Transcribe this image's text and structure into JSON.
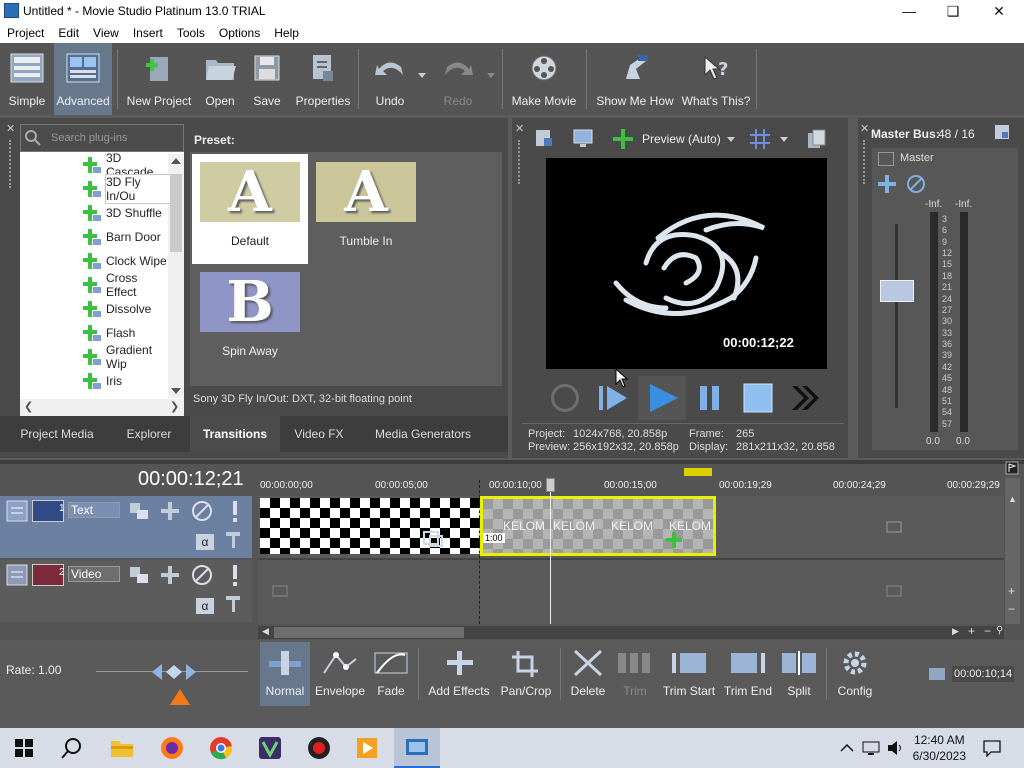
{
  "window": {
    "title": "Untitled * - Movie Studio Platinum 13.0 TRIAL"
  },
  "menu": [
    "Project",
    "Edit",
    "View",
    "Insert",
    "Tools",
    "Options",
    "Help"
  ],
  "toolbar": {
    "simple": "Simple",
    "advanced": "Advanced",
    "new_project": "New Project",
    "open": "Open",
    "save": "Save",
    "properties": "Properties",
    "undo": "Undo",
    "redo": "Redo",
    "make_movie": "Make Movie",
    "show_me_how": "Show Me How",
    "whats_this": "What's This?"
  },
  "plugins": {
    "search_placeholder": "Search plug-ins",
    "items": [
      "3D Cascade",
      "3D Fly In/Ou",
      "3D Shuffle",
      "Barn Door",
      "Clock Wipe",
      "Cross Effect",
      "Dissolve",
      "Flash",
      "Gradient Wip",
      "Iris"
    ],
    "selected_index": 1
  },
  "presets": {
    "heading": "Preset:",
    "items": [
      {
        "label": "Default",
        "glyph": "A"
      },
      {
        "label": "Tumble In",
        "glyph": "A"
      },
      {
        "label": "Spin Away",
        "glyph": "B"
      }
    ],
    "status": "Sony 3D Fly In/Out: DXT, 32-bit floating point"
  },
  "tabs": [
    "Project Media",
    "Explorer",
    "Transitions",
    "Video FX",
    "Media Generators"
  ],
  "preview": {
    "mode": "Preview (Auto)",
    "timecode": "00:00:12;22",
    "project_label": "Project:",
    "project_value": "1024x768, 20.858p",
    "preview_label": "Preview:",
    "preview_value": "256x192x32, 20.858p",
    "frame_label": "Frame:",
    "frame_value": "265",
    "display_label": "Display:",
    "display_value": "281x211x32, 20.858"
  },
  "master": {
    "title": "Master Bus:",
    "count": "48 / 16",
    "name": "Master",
    "peak_left": "-Inf.",
    "peak_right": "-Inf.",
    "scale": [
      "3",
      "6",
      "9",
      "12",
      "15",
      "18",
      "21",
      "24",
      "27",
      "30",
      "33",
      "36",
      "39",
      "42",
      "45",
      "48",
      "51",
      "54",
      "57"
    ],
    "bottom_left": "0.0",
    "bottom_right": "0.0"
  },
  "timeline": {
    "cursor": "00:00:12;21",
    "ruler": [
      "00:00:00;00",
      "00:00:05;00",
      "00:00:10;00",
      "00:00:15;00",
      "00:00:19;29",
      "00:00:24;29",
      "00:00:29;29"
    ],
    "tracks": [
      {
        "num": "1",
        "name": "Text"
      },
      {
        "num": "2",
        "name": "Video"
      }
    ],
    "clip_text": "KELOM",
    "transition_label": "1:00"
  },
  "bottom": {
    "rate": "Rate: 1.00",
    "normal": "Normal",
    "envelope": "Envelope",
    "fade": "Fade",
    "add_effects": "Add Effects",
    "pan_crop": "Pan/Crop",
    "delete": "Delete",
    "trim": "Trim",
    "trim_start": "Trim Start",
    "trim_end": "Trim End",
    "split": "Split",
    "config": "Config",
    "length": "00:00:10;14"
  },
  "taskbar": {
    "time": "12:40 AM",
    "date": "6/30/2023"
  },
  "colors": {
    "accent_selected": "#67788c",
    "clip_border": "#e6f000",
    "play_blue": "#3a8fe0"
  }
}
